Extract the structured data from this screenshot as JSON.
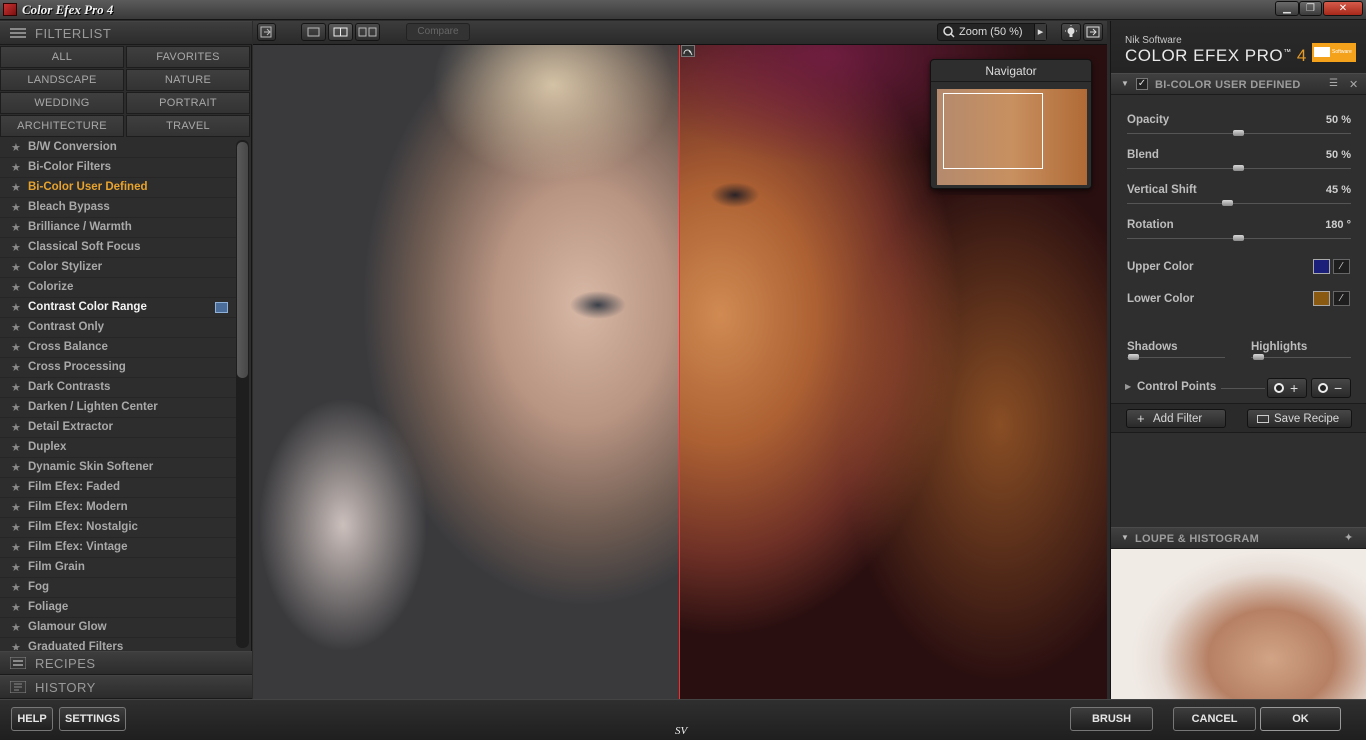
{
  "window": {
    "title": "Color Efex Pro 4",
    "minimize": "▁",
    "maximize": "❐",
    "close": "✕"
  },
  "left": {
    "filterlist_label": "FILTERLIST",
    "categories": [
      "ALL",
      "FAVORITES",
      "LANDSCAPE",
      "NATURE",
      "WEDDING",
      "PORTRAIT",
      "ARCHITECTURE",
      "TRAVEL"
    ],
    "filters": [
      "B/W Conversion",
      "Bi-Color Filters",
      "Bi-Color User Defined",
      "Bleach Bypass",
      "Brilliance / Warmth",
      "Classical Soft Focus",
      "Color Stylizer",
      "Colorize",
      "Contrast Color Range",
      "Contrast Only",
      "Cross Balance",
      "Cross Processing",
      "Dark Contrasts",
      "Darken / Lighten Center",
      "Detail Extractor",
      "Duplex",
      "Dynamic Skin Softener",
      "Film Efex: Faded",
      "Film Efex: Modern",
      "Film Efex: Nostalgic",
      "Film Efex: Vintage",
      "Film Grain",
      "Fog",
      "Foliage",
      "Glamour Glow",
      "Graduated Filters"
    ],
    "star": "★",
    "recipes_label": "RECIPES",
    "history_label": "HISTORY"
  },
  "toolbar": {
    "compare_label": "Compare",
    "zoom_label": "Zoom (50 %)",
    "zoom_arrow": "▸"
  },
  "navigator": {
    "title": "Navigator"
  },
  "right": {
    "nik_label": "Nik Software",
    "brand_main": "COLOR EFEX PRO",
    "brand_tm": "™",
    "brand_ver": "4",
    "logo_text": "Software",
    "filter_title": "BI-COLOR USER DEFINED",
    "checkbox": "✓",
    "params": [
      {
        "label": "Opacity",
        "value": "50 %",
        "level": 0.5
      },
      {
        "label": "Blend",
        "value": "50 %",
        "level": 0.5
      },
      {
        "label": "Vertical Shift",
        "value": "45 %",
        "level": 0.45
      },
      {
        "label": "Rotation",
        "value": "180 °",
        "level": 0.5
      }
    ],
    "upper_color_label": "Upper Color",
    "upper_color": "#1c1f7a",
    "lower_color_label": "Lower Color",
    "lower_color": "#8a5a12",
    "shadows_label": "Shadows",
    "highlights_label": "Highlights",
    "control_points_label": "Control Points",
    "cp_add": "+",
    "cp_remove": "−",
    "add_filter_label": "Add Filter",
    "save_recipe_label": "Save Recipe",
    "loupe_label": "LOUPE & HISTOGRAM"
  },
  "bottom": {
    "help": "HELP",
    "settings": "SETTINGS",
    "brush": "BRUSH",
    "cancel": "CANCEL",
    "ok": "OK",
    "signature": "SV"
  },
  "colors": {
    "accent_orange": "#e7a32e",
    "split_line": "#ff2a2a"
  }
}
